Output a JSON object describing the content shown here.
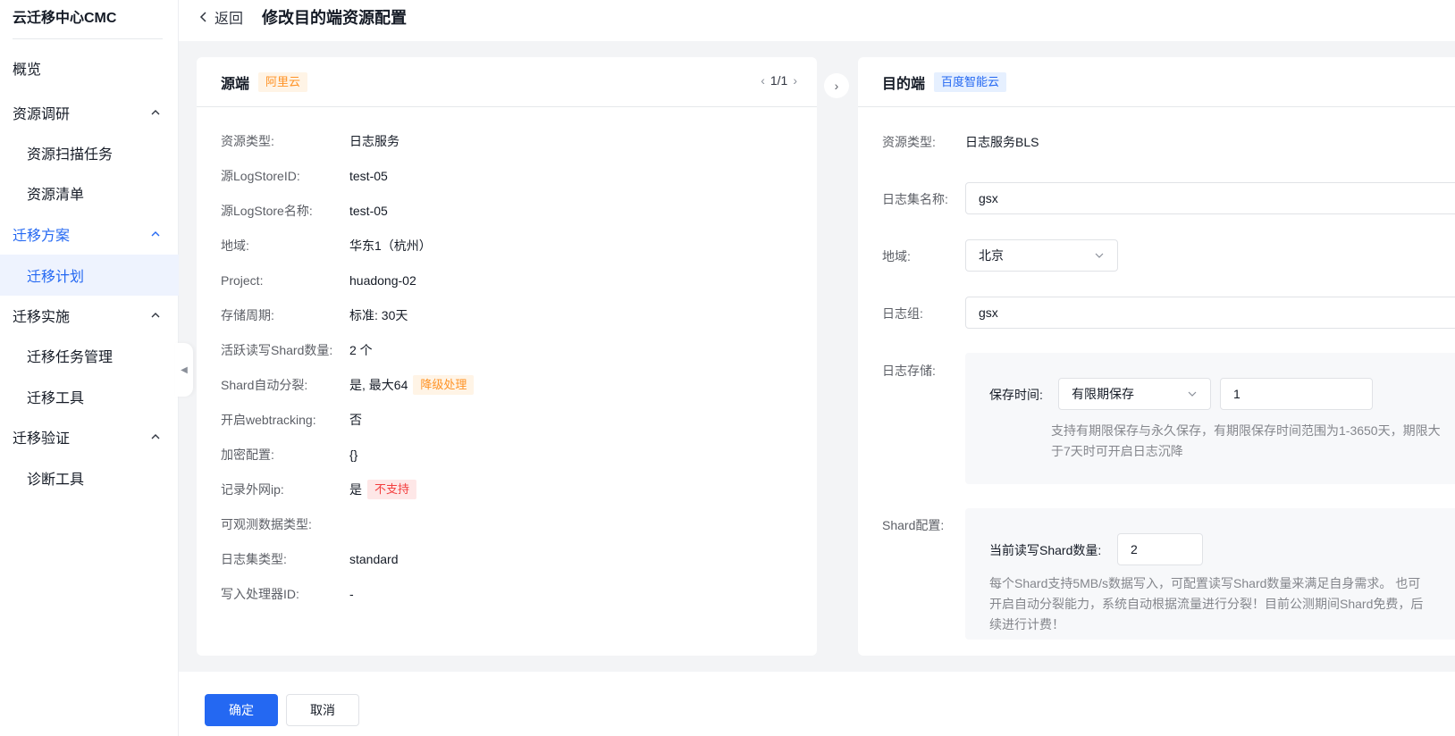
{
  "app": {
    "brand": "云迁移中心CMC"
  },
  "sidebar": {
    "items": [
      {
        "label": "概览"
      },
      {
        "label": "资源调研"
      },
      {
        "label": "资源扫描任务"
      },
      {
        "label": "资源清单"
      },
      {
        "label": "迁移方案"
      },
      {
        "label": "迁移计划"
      },
      {
        "label": "迁移实施"
      },
      {
        "label": "迁移任务管理"
      },
      {
        "label": "迁移工具"
      },
      {
        "label": "迁移验证"
      },
      {
        "label": "诊断工具"
      }
    ]
  },
  "header": {
    "back_label": "返回",
    "title": "修改目的端资源配置"
  },
  "source": {
    "title": "源端",
    "provider_tag": "阿里云",
    "pager": "1/1",
    "rows": [
      {
        "label": "资源类型:",
        "value": "日志服务"
      },
      {
        "label": "源LogStoreID:",
        "value": "test-05"
      },
      {
        "label": "源LogStore名称:",
        "value": "test-05"
      },
      {
        "label": "地域:",
        "value": "华东1（杭州）"
      },
      {
        "label": "Project:",
        "value": "huadong-02"
      },
      {
        "label": "存储周期:",
        "value": "标准: 30天"
      },
      {
        "label": "活跃读写Shard数量:",
        "value": "2 个"
      },
      {
        "label": "Shard自动分裂:",
        "value": "是, 最大64",
        "tag": "降级处理"
      },
      {
        "label": "开启webtracking:",
        "value": "否"
      },
      {
        "label": "加密配置:",
        "value": "{}"
      },
      {
        "label": "记录外网ip:",
        "value": "是",
        "tag": "不支持"
      },
      {
        "label": "可观测数据类型:",
        "value": ""
      },
      {
        "label": "日志集类型:",
        "value": "standard"
      },
      {
        "label": "写入处理器ID:",
        "value": "-"
      }
    ]
  },
  "target": {
    "title": "目的端",
    "provider_tag": "百度智能云",
    "resource_type_label": "资源类型:",
    "resource_type_value": "日志服务BLS",
    "logset_label": "日志集名称:",
    "logset_value": "gsx",
    "region_label": "地域:",
    "region_value": "北京",
    "loggroup_label": "日志组:",
    "loggroup_value": "gsx",
    "storage_label": "日志存储:",
    "retention_label": "保存时间:",
    "retention_mode": "有限期保存",
    "retention_days": "1",
    "retention_hint": "支持有期限保存与永久保存，有期限保存时间范围为1-3650天，期限大于7天时可开启日志沉降",
    "shard_label": "Shard配置:",
    "shard_count_label": "当前读写Shard数量:",
    "shard_count_value": "2",
    "shard_hint": "每个Shard支持5MB/s数据写入，可配置读写Shard数量来满足自身需求。 也可开启自动分裂能力，系统自动根据流量进行分裂！目前公测期间Shard免费，后续进行计费！"
  },
  "footer": {
    "confirm_label": "确定",
    "cancel_label": "取消"
  },
  "colors": {
    "primary": "#2468f2",
    "warning": "#ff9326",
    "danger": "#f33e3e"
  }
}
